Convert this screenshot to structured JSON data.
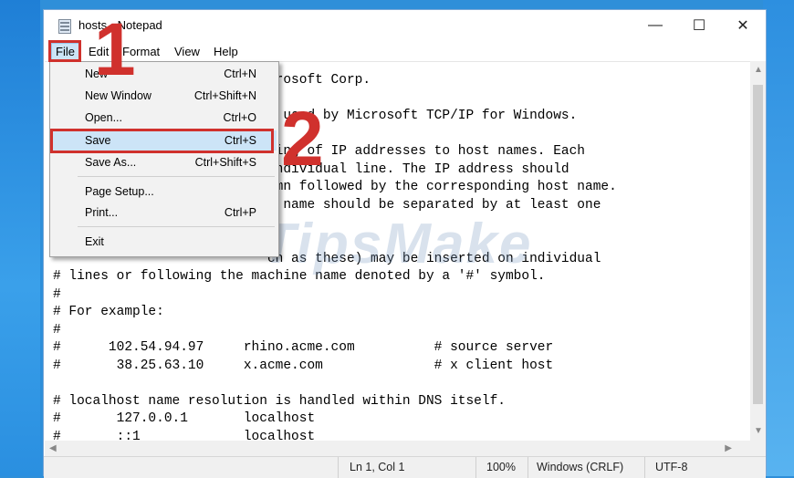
{
  "window": {
    "title": "hosts - Notepad",
    "controls": {
      "minimize": "—",
      "maximize": "☐",
      "close": "✕"
    }
  },
  "menubar": [
    "File",
    "Edit",
    "Format",
    "View",
    "Help"
  ],
  "file_menu": {
    "items": [
      {
        "label": "New",
        "shortcut": "Ctrl+N"
      },
      {
        "label": "New Window",
        "shortcut": "Ctrl+Shift+N"
      },
      {
        "label": "Open...",
        "shortcut": "Ctrl+O"
      },
      {
        "label": "Save",
        "shortcut": "Ctrl+S"
      },
      {
        "label": "Save As...",
        "shortcut": "Ctrl+Shift+S"
      },
      {
        "label": "Page Setup...",
        "shortcut": ""
      },
      {
        "label": "Print...",
        "shortcut": "Ctrl+P"
      },
      {
        "label": "Exit",
        "shortcut": ""
      }
    ]
  },
  "editor_lines": [
    "                           crosoft Corp.",
    "",
    "                           e used by Microsoft TCP/IP for Windows.",
    "",
    "                           ping of IP addresses to host names. Each",
    "                           individual line. The IP address should",
    "                           umn followed by the corresponding host name.",
    "                           t name should be separated by at least one",
    "",
    "                           ch as these) may be inserted on individual",
    "# lines or following the machine name denoted by a '#' symbol.",
    "#",
    "# For example:",
    "#",
    "#      102.54.94.97     rhino.acme.com          # source server",
    "#       38.25.63.10     x.acme.com              # x client host",
    "",
    "# localhost name resolution is handled within DNS itself.",
    "#       127.0.0.1       localhost",
    "#       ::1             localhost"
  ],
  "status": {
    "position": "Ln 1, Col 1",
    "zoom": "100%",
    "line_ending": "Windows (CRLF)",
    "encoding": "UTF-8"
  },
  "annotations": {
    "step1": "1",
    "step2": "2"
  },
  "watermark": "TipsMake",
  "colors": {
    "highlight": "#d0312d",
    "menu_selected": "#cce4f7"
  }
}
